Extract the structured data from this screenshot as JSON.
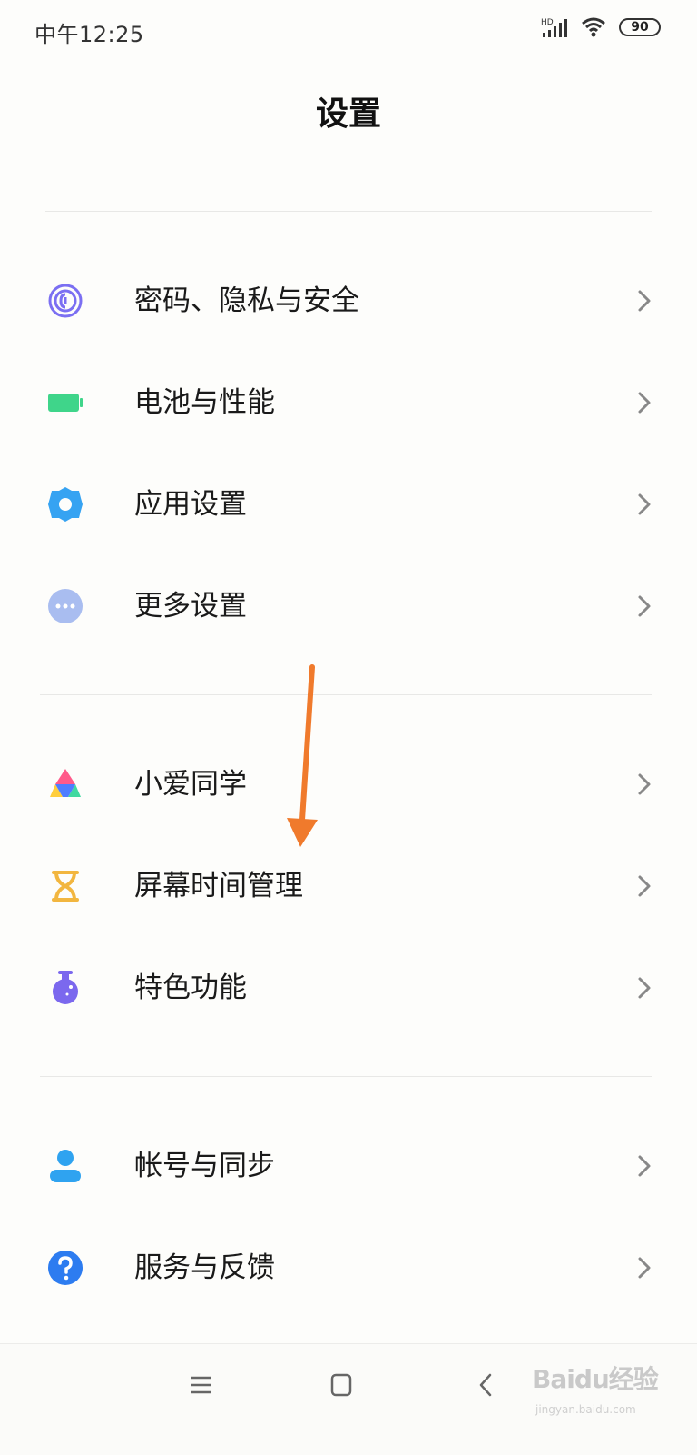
{
  "status": {
    "time": "中午12:25",
    "network": "HD",
    "battery": "90"
  },
  "page": {
    "title": "设置"
  },
  "items": [
    {
      "label": "密码、隐私与安全",
      "icon": "fingerprint-icon"
    },
    {
      "label": "电池与性能",
      "icon": "battery-icon"
    },
    {
      "label": "应用设置",
      "icon": "gear-icon"
    },
    {
      "label": "更多设置",
      "icon": "more-icon"
    },
    {
      "label": "小爱同学",
      "icon": "xiaoai-icon"
    },
    {
      "label": "屏幕时间管理",
      "icon": "hourglass-icon"
    },
    {
      "label": "特色功能",
      "icon": "flask-icon"
    },
    {
      "label": "帐号与同步",
      "icon": "account-icon"
    },
    {
      "label": "服务与反馈",
      "icon": "help-icon"
    }
  ],
  "navigation": {
    "menu": "menu-icon",
    "home": "home-icon",
    "back": "back-icon"
  },
  "watermark": {
    "brand": "Baidu经验",
    "site": "jingyan.baidu.com"
  },
  "colors": {
    "fingerprint": "#7b6ff2",
    "battery": "#3fd58a",
    "gear": "#36a3f2",
    "more": "#a9bdf0",
    "hourglass": "#f2b63f",
    "flask": "#7b68ee",
    "account": "#2fa3f0",
    "help": "#2d7cf0",
    "arrow": "#f07a2c"
  }
}
